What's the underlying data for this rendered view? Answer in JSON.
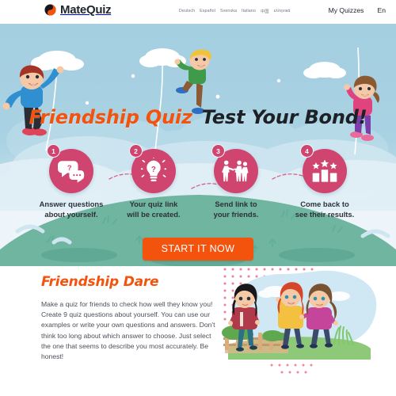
{
  "header": {
    "logo_text": "MateQuiz",
    "logo_icon": "circle-yinyang-icon",
    "languages": [
      {
        "label": "Deutsch"
      },
      {
        "label": "Español"
      },
      {
        "label": "Svenska"
      },
      {
        "label": "Italiano"
      },
      {
        "label": "中国"
      },
      {
        "label": "ελληνικά"
      }
    ],
    "my_quizzes_label": "My Quizzes",
    "current_language": "En",
    "flag_icon": "us-flag-icon"
  },
  "hero": {
    "title_part1": "Friendship Quiz",
    "title_part2": "Test Your Bond!",
    "title_color_1": "#f4530e",
    "title_color_2": "#1d2024",
    "sky_color": "#9dcce0",
    "hill_color": "#6fb5a0",
    "steps": [
      {
        "number": "1",
        "icon": "speech-bubbles-question-icon",
        "caption_line1": "Answer questions",
        "caption_line2": "about yourself."
      },
      {
        "number": "2",
        "icon": "lightbulb-question-icon",
        "caption_line1": "Your quiz link",
        "caption_line2": "will be created."
      },
      {
        "number": "3",
        "icon": "people-sharing-icon",
        "caption_line1": "Send link to",
        "caption_line2": "your friends."
      },
      {
        "number": "4",
        "icon": "bar-chart-stars-icon",
        "caption_line1": "Come back to",
        "caption_line2": "see their results."
      }
    ],
    "step_circle_color": "#cf4570",
    "cta_label": "START IT NOW",
    "cta_color": "#f4530e",
    "characters": [
      {
        "name": "boy-climbing-rope-left",
        "shirt": "#2f8fd0",
        "hair": "#a33426"
      },
      {
        "name": "boy-climbing-rope-middle",
        "shirt": "#3f9a4a",
        "hair": "#f0c33a"
      },
      {
        "name": "girl-climbing-rope-right",
        "shirt": "#e0447f",
        "hair": "#8b5a32"
      }
    ]
  },
  "lower": {
    "title": "Friendship Dare",
    "title_color": "#f4530e",
    "body": "Make a quiz for friends to check how well they know you! Create 9 quiz questions about yourself. You can use our examples or write your own questions and answers. Don't think too long about which answer to choose. Just select the one that seems to describe you most accurately. Be honest!",
    "illustration": "three-kids-walking-illustration",
    "illustration_blob_color": "#cfe8f3",
    "illustration_dots_color": "#ec6a8c"
  }
}
